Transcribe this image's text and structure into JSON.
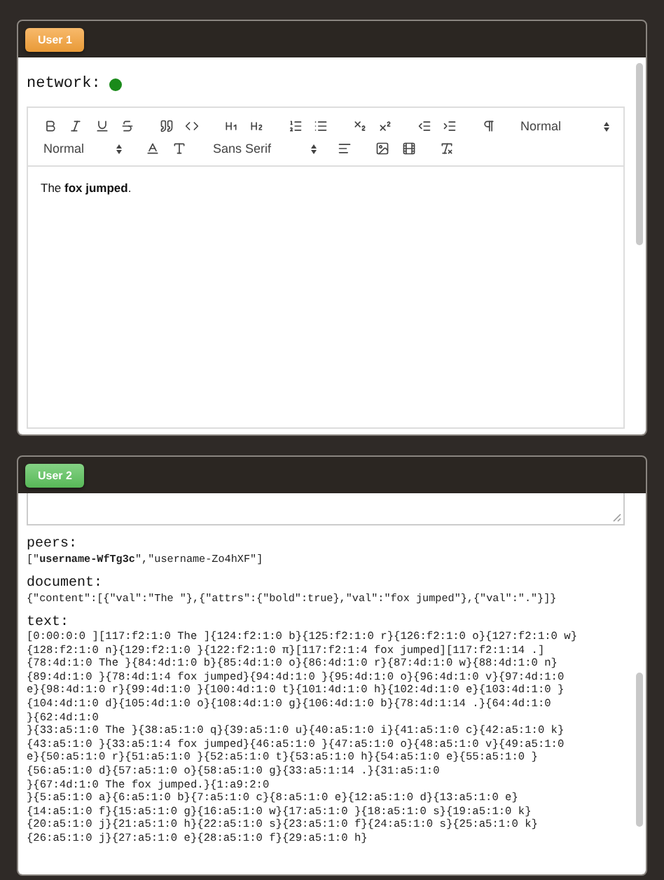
{
  "panels": [
    {
      "kind": "editor",
      "tab": {
        "label": "User 1",
        "color": "#f5a23a"
      },
      "network": {
        "label": "network:",
        "online": true
      },
      "pickers": [
        "Normal",
        "Normal",
        "Sans Serif"
      ],
      "content": "The **fox jumped**."
    },
    {
      "kind": "state",
      "tab": {
        "label": "User 2",
        "color": "#5cc25c"
      },
      "sections": [
        {
          "label": "peers:",
          "value": "[\"**username-WfTg3c**\",\"username-Zo4hXF\"]"
        },
        {
          "label": "document:",
          "value": "{\"content\":[{\"val\":\"The \"},{\"attrs\":{\"bold\":true},\"val\":\"fox jumped\"},{\"val\":\".\"}]}"
        }
      ],
      "text": {
        "label": "text:",
        "lines": [
          "[0:00:0:0 ][117:f2:1:0 The ]{124:f2:1:0 b}{125:f2:1:0 r}{126:f2:1:0 o}{127:f2:1:0 w}",
          "{128:f2:1:0 n}{129:f2:1:0 }{122:f2:1:0 π}[117:f2:1:4 fox jumped][117:f2:1:14 .]",
          "{78:4d:1:0 The }{84:4d:1:0 b}{85:4d:1:0 o}{86:4d:1:0 r}{87:4d:1:0 w}{88:4d:1:0 n}",
          "{89:4d:1:0 }{78:4d:1:4 fox jumped}{94:4d:1:0 }{95:4d:1:0 o}{96:4d:1:0 v}{97:4d:1:0",
          "e}{98:4d:1:0 r}{99:4d:1:0 }{100:4d:1:0 t}{101:4d:1:0 h}{102:4d:1:0 e}{103:4d:1:0 }",
          "{104:4d:1:0 d}{105:4d:1:0 o}{108:4d:1:0 g}{106:4d:1:0 b}{78:4d:1:14 .}{64:4d:1:0",
          "}{62:4d:1:0",
          "}{33:a5:1:0 The }{38:a5:1:0 q}{39:a5:1:0 u}{40:a5:1:0 i}{41:a5:1:0 c}{42:a5:1:0 k}",
          "{43:a5:1:0 }{33:a5:1:4 fox jumped}{46:a5:1:0 }{47:a5:1:0 o}{48:a5:1:0 v}{49:a5:1:0",
          "e}{50:a5:1:0 r}{51:a5:1:0 }{52:a5:1:0 t}{53:a5:1:0 h}{54:a5:1:0 e}{55:a5:1:0 }",
          "{56:a5:1:0 d}{57:a5:1:0 o}{58:a5:1:0 g}{33:a5:1:14 .}{31:a5:1:0",
          "}{67:4d:1:0 The fox jumped.}{1:a9:2:0",
          "}{5:a5:1:0 a}{6:a5:1:0 b}{7:a5:1:0 c}{8:a5:1:0 e}{12:a5:1:0 d}{13:a5:1:0 e}",
          "{14:a5:1:0 f}{15:a5:1:0 g}{16:a5:1:0 w}{17:a5:1:0 }{18:a5:1:0 s}{19:a5:1:0 k}",
          "{20:a5:1:0 j}{21:a5:1:0 h}{22:a5:1:0 s}{23:a5:1:0 f}{24:a5:1:0 s}{25:a5:1:0 k}",
          "{26:a5:1:0 j}{27:a5:1:0 e}{28:a5:1:0 f}{29:a5:1:0 h}"
        ]
      }
    }
  ]
}
